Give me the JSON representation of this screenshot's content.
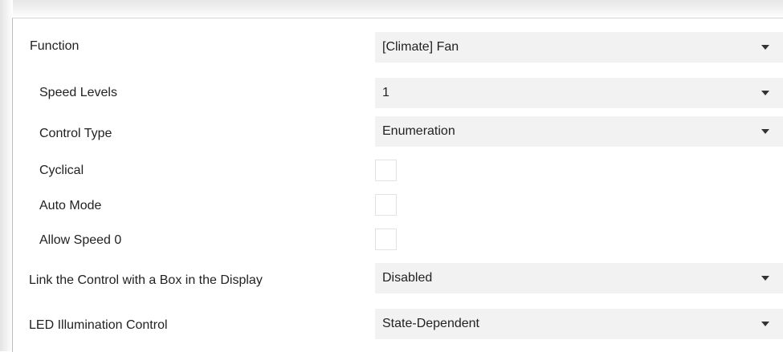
{
  "rows": {
    "function": {
      "label": "Function",
      "value": "[Climate] Fan"
    },
    "speed_levels": {
      "label": "Speed Levels",
      "value": "1"
    },
    "control_type": {
      "label": "Control Type",
      "value": "Enumeration"
    },
    "cyclical": {
      "label": "Cyclical",
      "checked": false
    },
    "auto_mode": {
      "label": "Auto Mode",
      "checked": false
    },
    "allow_speed_0": {
      "label": "Allow Speed 0",
      "checked": false
    },
    "link_control": {
      "label": "Link the Control with a Box in the Display",
      "value": "Disabled"
    },
    "led_illumination": {
      "label": "LED Illumination Control",
      "value": "State-Dependent"
    }
  },
  "icons": {
    "dropdown": "chevron-down-icon"
  },
  "colors": {
    "select_background": "#f2f2f2",
    "checkbox_border": "#e2e2e2",
    "text": "#222222"
  }
}
